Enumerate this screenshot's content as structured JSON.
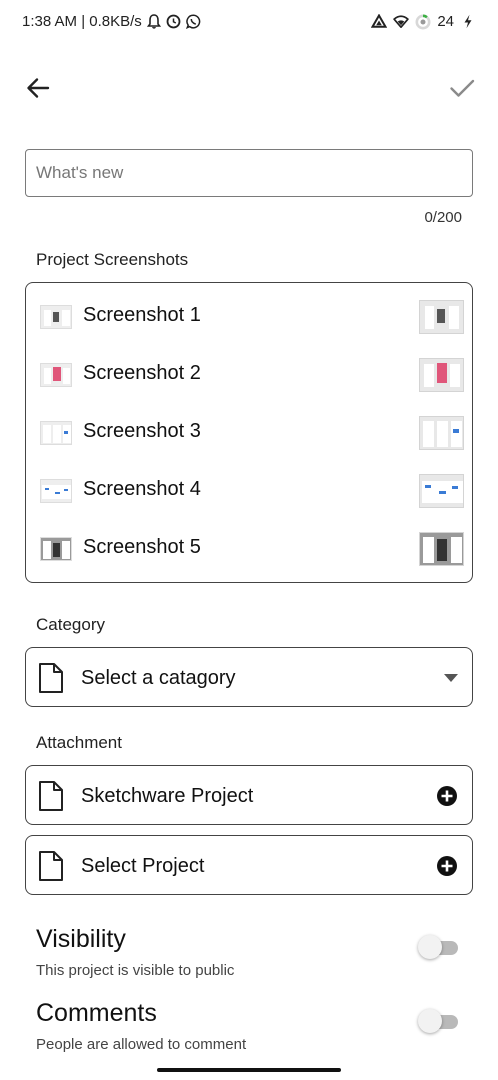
{
  "status_bar": {
    "time_text": "1:38 AM | 0.8KB/s",
    "battery_level": "24",
    "left_icons": [
      "notification-bell-icon",
      "alarm-icon",
      "whatsapp-icon"
    ],
    "right_icons": [
      "drive-icon",
      "wifi-icon",
      "battery-ring-icon",
      "charging-bolt-icon"
    ]
  },
  "top_bar": {
    "back_icon": "arrow-left-icon",
    "done_icon": "check-icon"
  },
  "whats_new": {
    "placeholder": "What's new",
    "value": "",
    "char_count": "0/200"
  },
  "screenshots": {
    "section_label": "Project Screenshots",
    "items": [
      {
        "label": "Screenshot 1"
      },
      {
        "label": "Screenshot 2"
      },
      {
        "label": "Screenshot 3"
      },
      {
        "label": "Screenshot 4"
      },
      {
        "label": "Screenshot 5"
      }
    ]
  },
  "category": {
    "section_label": "Category",
    "selected_text": "Select a catagory"
  },
  "attachment": {
    "section_label": "Attachment",
    "items": [
      {
        "label": "Sketchware Project"
      },
      {
        "label": "Select Project"
      }
    ]
  },
  "visibility": {
    "title": "Visibility",
    "subtitle": "This project is visible to public",
    "enabled": false
  },
  "comments": {
    "title": "Comments",
    "subtitle": "People are allowed to comment",
    "enabled": false
  },
  "colors": {
    "border": "#444444",
    "switch_track_off": "#b9b9b9",
    "switch_thumb_off": "#f2f2f2",
    "accent_pink": "#e0567a",
    "accent_blue": "#3a7bd5"
  }
}
